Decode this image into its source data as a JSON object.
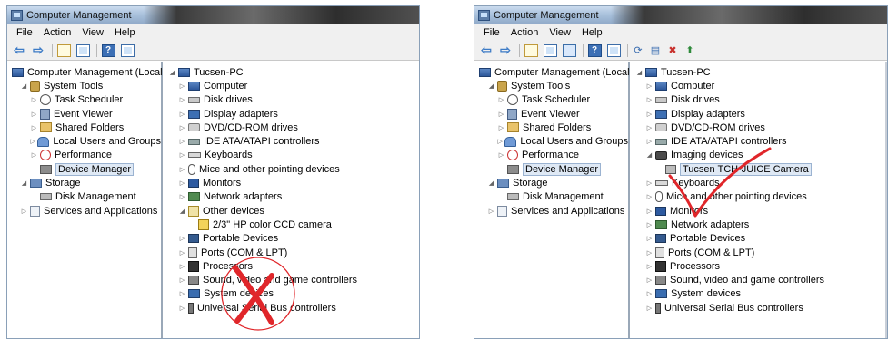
{
  "windows": [
    {
      "title": "Computer Management",
      "menu": [
        "File",
        "Action",
        "View",
        "Help"
      ],
      "tree": [
        {
          "label": "Computer Management (Local",
          "level": 0,
          "expander": "",
          "icon": "computer-management-icon",
          "selected": false
        },
        {
          "label": "System Tools",
          "level": 1,
          "expander": "◢",
          "icon": "system-tools-icon",
          "selected": false
        },
        {
          "label": "Task Scheduler",
          "level": 2,
          "expander": "▷",
          "icon": "task-scheduler-icon",
          "selected": false
        },
        {
          "label": "Event Viewer",
          "level": 2,
          "expander": "▷",
          "icon": "event-viewer-icon",
          "selected": false
        },
        {
          "label": "Shared Folders",
          "level": 2,
          "expander": "▷",
          "icon": "shared-folders-icon",
          "selected": false
        },
        {
          "label": "Local Users and Groups",
          "level": 2,
          "expander": "▷",
          "icon": "local-users-icon",
          "selected": false
        },
        {
          "label": "Performance",
          "level": 2,
          "expander": "▷",
          "icon": "performance-icon",
          "selected": false
        },
        {
          "label": "Device Manager",
          "level": 2,
          "expander": "",
          "icon": "device-manager-icon",
          "selected": true
        },
        {
          "label": "Storage",
          "level": 1,
          "expander": "◢",
          "icon": "storage-icon",
          "selected": false
        },
        {
          "label": "Disk Management",
          "level": 2,
          "expander": "",
          "icon": "disk-management-icon",
          "selected": false
        },
        {
          "label": "Services and Applications",
          "level": 1,
          "expander": "▷",
          "icon": "services-applications-icon",
          "selected": false
        }
      ],
      "devices": [
        {
          "label": "Tucsen-PC",
          "level": 0,
          "expander": "◢",
          "icon": "computer-icon"
        },
        {
          "label": "Computer",
          "level": 1,
          "expander": "▷",
          "icon": "computer-icon"
        },
        {
          "label": "Disk drives",
          "level": 1,
          "expander": "▷",
          "icon": "disk-drive-icon"
        },
        {
          "label": "Display adapters",
          "level": 1,
          "expander": "▷",
          "icon": "display-adapter-icon"
        },
        {
          "label": "DVD/CD-ROM drives",
          "level": 1,
          "expander": "▷",
          "icon": "dvd-drive-icon"
        },
        {
          "label": "IDE ATA/ATAPI controllers",
          "level": 1,
          "expander": "▷",
          "icon": "ide-controller-icon"
        },
        {
          "label": "Keyboards",
          "level": 1,
          "expander": "▷",
          "icon": "keyboard-icon"
        },
        {
          "label": "Mice and other pointing devices",
          "level": 1,
          "expander": "▷",
          "icon": "mouse-icon"
        },
        {
          "label": "Monitors",
          "level": 1,
          "expander": "▷",
          "icon": "monitor-icon"
        },
        {
          "label": "Network adapters",
          "level": 1,
          "expander": "▷",
          "icon": "network-adapter-icon"
        },
        {
          "label": "Other devices",
          "level": 1,
          "expander": "◢",
          "icon": "other-devices-icon"
        },
        {
          "label": "2/3\" HP color CCD camera",
          "level": 2,
          "expander": "",
          "icon": "unknown-device-warning-icon"
        },
        {
          "label": "Portable Devices",
          "level": 1,
          "expander": "▷",
          "icon": "portable-devices-icon"
        },
        {
          "label": "Ports (COM & LPT)",
          "level": 1,
          "expander": "▷",
          "icon": "ports-icon"
        },
        {
          "label": "Processors",
          "level": 1,
          "expander": "▷",
          "icon": "processor-icon"
        },
        {
          "label": "Sound, video and game controllers",
          "level": 1,
          "expander": "▷",
          "icon": "sound-icon"
        },
        {
          "label": "System devices",
          "level": 1,
          "expander": "▷",
          "icon": "system-devices-icon"
        },
        {
          "label": "Universal Serial Bus controllers",
          "level": 1,
          "expander": "▷",
          "icon": "usb-icon"
        }
      ],
      "annotation": {
        "type": "cross",
        "color": "#e0262a"
      }
    },
    {
      "title": "Computer Management",
      "menu": [
        "File",
        "Action",
        "View",
        "Help"
      ],
      "tree": [
        {
          "label": "Computer Management (Local",
          "level": 0,
          "expander": "",
          "icon": "computer-management-icon",
          "selected": false
        },
        {
          "label": "System Tools",
          "level": 1,
          "expander": "◢",
          "icon": "system-tools-icon",
          "selected": false
        },
        {
          "label": "Task Scheduler",
          "level": 2,
          "expander": "▷",
          "icon": "task-scheduler-icon",
          "selected": false
        },
        {
          "label": "Event Viewer",
          "level": 2,
          "expander": "▷",
          "icon": "event-viewer-icon",
          "selected": false
        },
        {
          "label": "Shared Folders",
          "level": 2,
          "expander": "▷",
          "icon": "shared-folders-icon",
          "selected": false
        },
        {
          "label": "Local Users and Groups",
          "level": 2,
          "expander": "▷",
          "icon": "local-users-icon",
          "selected": false
        },
        {
          "label": "Performance",
          "level": 2,
          "expander": "▷",
          "icon": "performance-icon",
          "selected": false
        },
        {
          "label": "Device Manager",
          "level": 2,
          "expander": "",
          "icon": "device-manager-icon",
          "selected": true
        },
        {
          "label": "Storage",
          "level": 1,
          "expander": "◢",
          "icon": "storage-icon",
          "selected": false
        },
        {
          "label": "Disk Management",
          "level": 2,
          "expander": "",
          "icon": "disk-management-icon",
          "selected": false
        },
        {
          "label": "Services and Applications",
          "level": 1,
          "expander": "▷",
          "icon": "services-applications-icon",
          "selected": false
        }
      ],
      "devices": [
        {
          "label": "Tucsen-PC",
          "level": 0,
          "expander": "◢",
          "icon": "computer-icon"
        },
        {
          "label": "Computer",
          "level": 1,
          "expander": "▷",
          "icon": "computer-icon"
        },
        {
          "label": "Disk drives",
          "level": 1,
          "expander": "▷",
          "icon": "disk-drive-icon"
        },
        {
          "label": "Display adapters",
          "level": 1,
          "expander": "▷",
          "icon": "display-adapter-icon"
        },
        {
          "label": "DVD/CD-ROM drives",
          "level": 1,
          "expander": "▷",
          "icon": "dvd-drive-icon"
        },
        {
          "label": "IDE ATA/ATAPI controllers",
          "level": 1,
          "expander": "▷",
          "icon": "ide-controller-icon"
        },
        {
          "label": "Imaging devices",
          "level": 1,
          "expander": "◢",
          "icon": "imaging-devices-icon"
        },
        {
          "label": "Tucsen TCH-JUICE Camera",
          "level": 2,
          "expander": "",
          "icon": "camera-icon",
          "selected": true
        },
        {
          "label": "Keyboards",
          "level": 1,
          "expander": "▷",
          "icon": "keyboard-icon"
        },
        {
          "label": "Mice and other pointing devices",
          "level": 1,
          "expander": "▷",
          "icon": "mouse-icon"
        },
        {
          "label": "Monitors",
          "level": 1,
          "expander": "▷",
          "icon": "monitor-icon"
        },
        {
          "label": "Network adapters",
          "level": 1,
          "expander": "▷",
          "icon": "network-adapter-icon"
        },
        {
          "label": "Portable Devices",
          "level": 1,
          "expander": "▷",
          "icon": "portable-devices-icon"
        },
        {
          "label": "Ports (COM & LPT)",
          "level": 1,
          "expander": "▷",
          "icon": "ports-icon"
        },
        {
          "label": "Processors",
          "level": 1,
          "expander": "▷",
          "icon": "processor-icon"
        },
        {
          "label": "Sound, video and game controllers",
          "level": 1,
          "expander": "▷",
          "icon": "sound-icon"
        },
        {
          "label": "System devices",
          "level": 1,
          "expander": "▷",
          "icon": "system-devices-icon"
        },
        {
          "label": "Universal Serial Bus controllers",
          "level": 1,
          "expander": "▷",
          "icon": "usb-icon"
        }
      ],
      "annotation": {
        "type": "checkmark",
        "color": "#e0262a"
      }
    }
  ],
  "icons": {
    "back": "back-arrow-icon",
    "forward": "forward-arrow-icon"
  }
}
